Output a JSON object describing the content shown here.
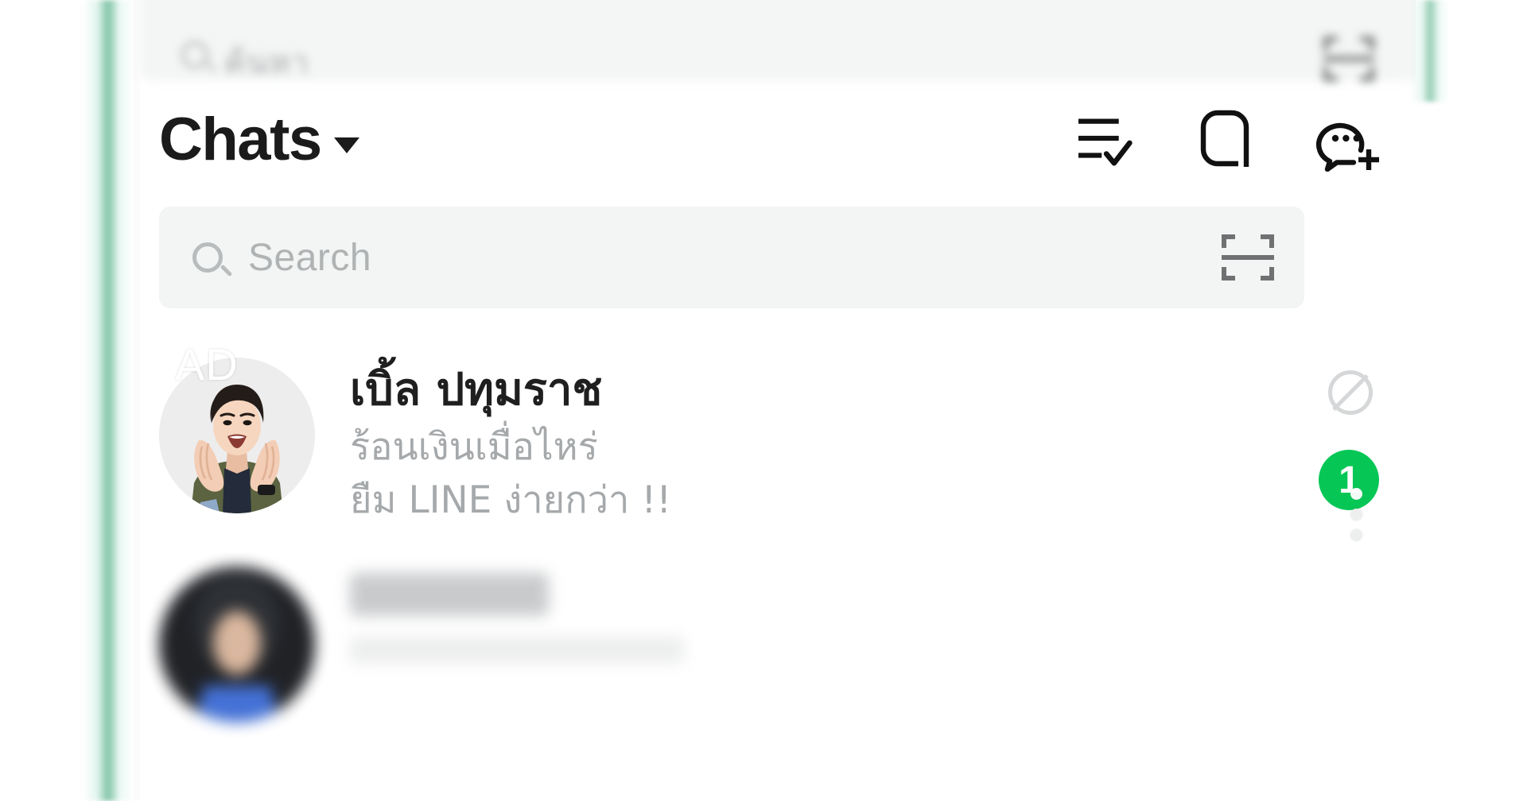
{
  "app": {
    "accent_green": "#06C755",
    "window_edge_green": "#8BC8AE",
    "background": "#FFFFFF"
  },
  "top_blurred_bar": {
    "search_icon": "search-icon",
    "search_placeholder": "ค้นหา",
    "right_icon": "scan-code-icon"
  },
  "header": {
    "title": "Chats",
    "dropdown_icon": "chevron-down-icon",
    "actions": [
      {
        "name": "select-chats-icon",
        "label": "Select chats"
      },
      {
        "name": "open-chat-icon",
        "label": "Open chat"
      },
      {
        "name": "new-chat-icon",
        "label": "New chat"
      }
    ]
  },
  "search": {
    "placeholder": "Search",
    "value": "",
    "leading_icon": "search-icon",
    "trailing_icon": "scan-code-icon"
  },
  "chat_list": [
    {
      "ad_label": "AD",
      "avatar": "man-cupping-hands-shouting-photo",
      "name": "เบิ้ล ปทุมราช",
      "preview_line1": "ร้อนเงินเมื่อไหร่",
      "preview_line2": "ยืม LINE ง่ายกว่า !!",
      "status_icon": "block-icon",
      "unread_count": "1",
      "blurred": false
    },
    {
      "ad_label": "",
      "avatar": "person-photo",
      "name": "Nachita",
      "preview_line1": "",
      "preview_line2": "",
      "status_icon": "",
      "unread_count": "",
      "blurred": true
    }
  ]
}
